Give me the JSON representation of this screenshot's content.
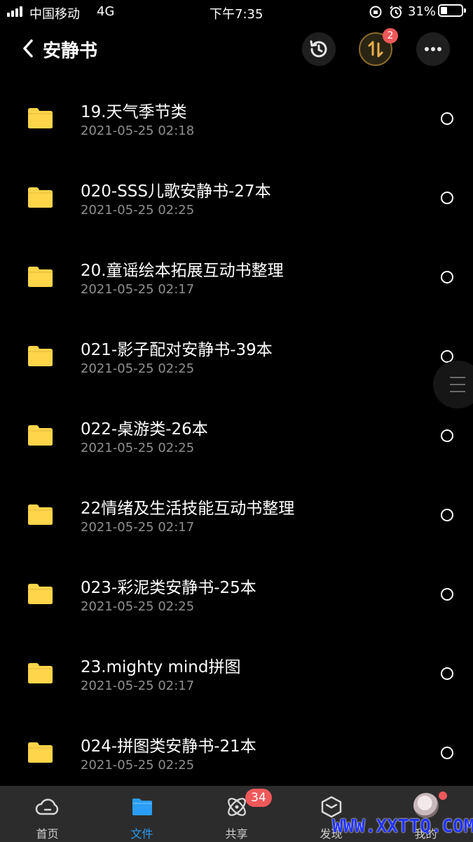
{
  "status_bar": {
    "carrier": "中国移动",
    "network": "4G",
    "time": "下午7:35",
    "battery": "31%",
    "battery_level": 0.31
  },
  "header": {
    "back_icon": "chevron-left-icon",
    "title": "安静书",
    "history_icon": "history-icon",
    "transfer_icon": "transfer-icon",
    "transfer_badge": "2",
    "more_icon": "more-icon"
  },
  "folders": [
    {
      "name": "19.天气季节类",
      "date": "2021-05-25 02:18"
    },
    {
      "name": "020-SSS儿歌安静书-27本",
      "date": "2021-05-25 02:25"
    },
    {
      "name": "20.童谣绘本拓展互动书整理",
      "date": "2021-05-25 02:17"
    },
    {
      "name": "021-影子配对安静书-39本",
      "date": "2021-05-25 02:25"
    },
    {
      "name": "022-桌游类-26本",
      "date": "2021-05-25 02:25"
    },
    {
      "name": "22情绪及生活技能互动书整理",
      "date": "2021-05-25 02:17"
    },
    {
      "name": "023-彩泥类安静书-25本",
      "date": "2021-05-25 02:25"
    },
    {
      "name": "23.mighty mind拼图",
      "date": "2021-05-25 02:17"
    },
    {
      "name": "024-拼图类安静书-21本",
      "date": "2021-05-25 02:25"
    }
  ],
  "colors": {
    "folder": "#FFD54A",
    "accent": "#2A9DF4",
    "badge": "#F0585A",
    "background": "#000000",
    "tabbar": "#2C2C2C"
  },
  "tabbar": {
    "tabs": [
      {
        "label": "首页",
        "icon": "cloud-icon"
      },
      {
        "label": "文件",
        "icon": "folder-icon",
        "active": true
      },
      {
        "label": "共享",
        "icon": "share-icon",
        "badge": "34"
      },
      {
        "label": "发现",
        "icon": "discover-icon"
      },
      {
        "label": "我的",
        "icon": "avatar"
      }
    ]
  },
  "watermark": "WWW.XXTTQ.COM"
}
